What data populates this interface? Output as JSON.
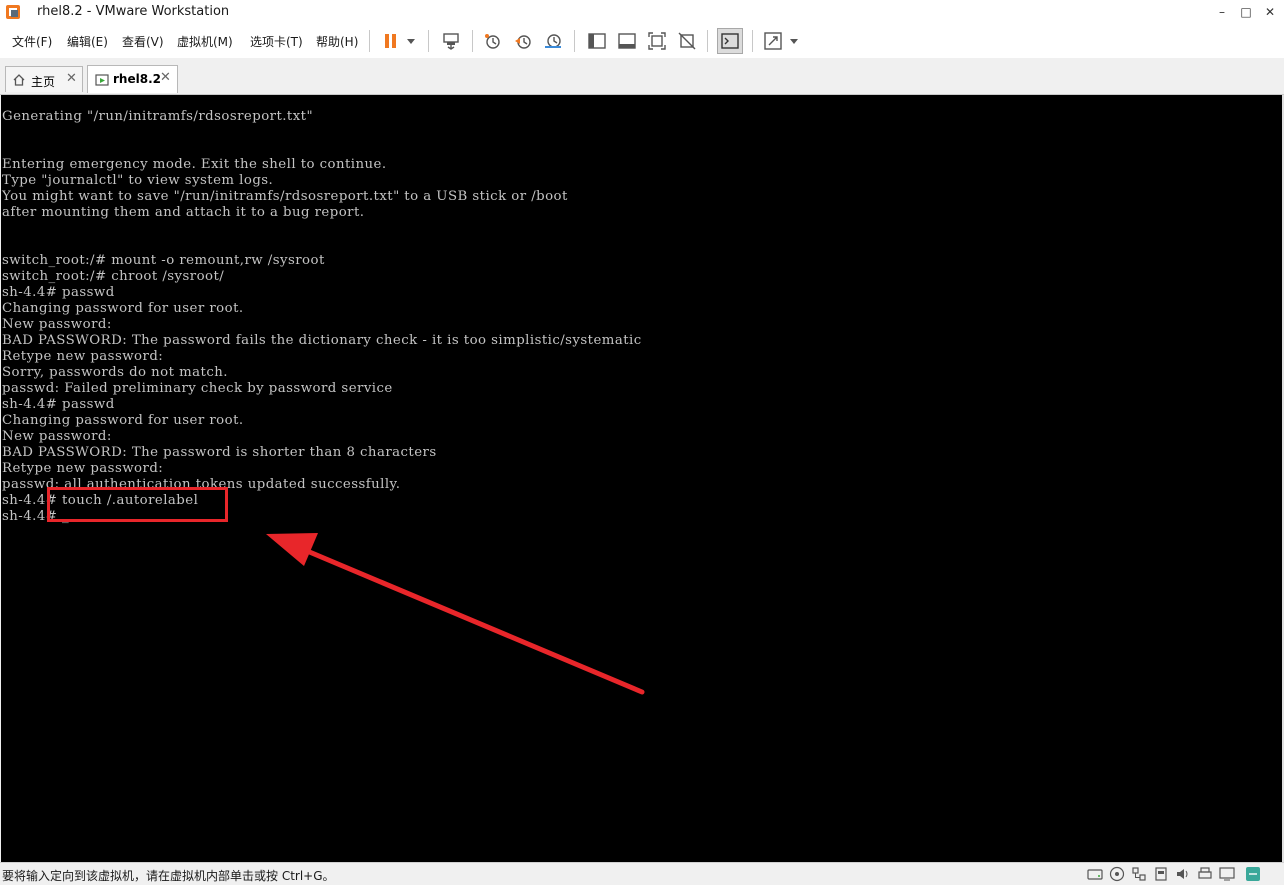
{
  "window": {
    "title": "rhel8.2 - VMware Workstation",
    "minimize": "–",
    "maximize": "□",
    "close": "✕"
  },
  "menu": {
    "file": "文件(F)",
    "edit": "编辑(E)",
    "view": "查看(V)",
    "vm": "虚拟机(M)",
    "tabs": "选项卡(T)",
    "help": "帮助(H)"
  },
  "toolbar": {
    "icons": [
      "pause-icon",
      "dropdown-arrow-icon",
      "send-ctrl-alt-del-icon",
      "snapshot-icon",
      "revert-snapshot-icon",
      "snapshot-manager-icon",
      "show-library-icon",
      "thumbnail-bar-icon",
      "full-screen-icon",
      "unity-icon",
      "console-view-icon",
      "stretch-guest-icon",
      "dropdown-arrow-icon"
    ],
    "accent": "#f07820"
  },
  "tabs": [
    {
      "label": "主页",
      "close": "✕",
      "active": false
    },
    {
      "label": "rhel8.2",
      "close": "✕",
      "active": true
    }
  ],
  "terminal": {
    "lines": [
      "Generating \"/run/initramfs/rdsosreport.txt\"",
      "",
      "",
      "Entering emergency mode. Exit the shell to continue.",
      "Type \"journalctl\" to view system logs.",
      "You might want to save \"/run/initramfs/rdsosreport.txt\" to a USB stick or /boot",
      "after mounting them and attach it to a bug report.",
      "",
      "",
      "switch_root:/# mount -o remount,rw /sysroot",
      "switch_root:/# chroot /sysroot/",
      "sh-4.4# passwd",
      "Changing password for user root.",
      "New password:",
      "BAD PASSWORD: The password fails the dictionary check - it is too simplistic/systematic",
      "Retype new password:",
      "Sorry, passwords do not match.",
      "passwd: Failed preliminary check by password service",
      "sh-4.4# passwd",
      "Changing password for user root.",
      "New password:",
      "BAD PASSWORD: The password is shorter than 8 characters",
      "Retype new password:",
      "passwd: all authentication tokens updated successfully.",
      "sh-4.4# touch /.autorelabel",
      "sh-4.4# _"
    ],
    "highlight_color": "#e8262a"
  },
  "status": {
    "text": "要将输入定向到该虚拟机，请在虚拟机内部单击或按 Ctrl+G。",
    "icons": [
      "hard-disk-icon",
      "cd-dvd-icon",
      "network-icon",
      "usb-icon",
      "sound-icon",
      "printer-icon",
      "display-icon",
      "message-icon"
    ]
  }
}
